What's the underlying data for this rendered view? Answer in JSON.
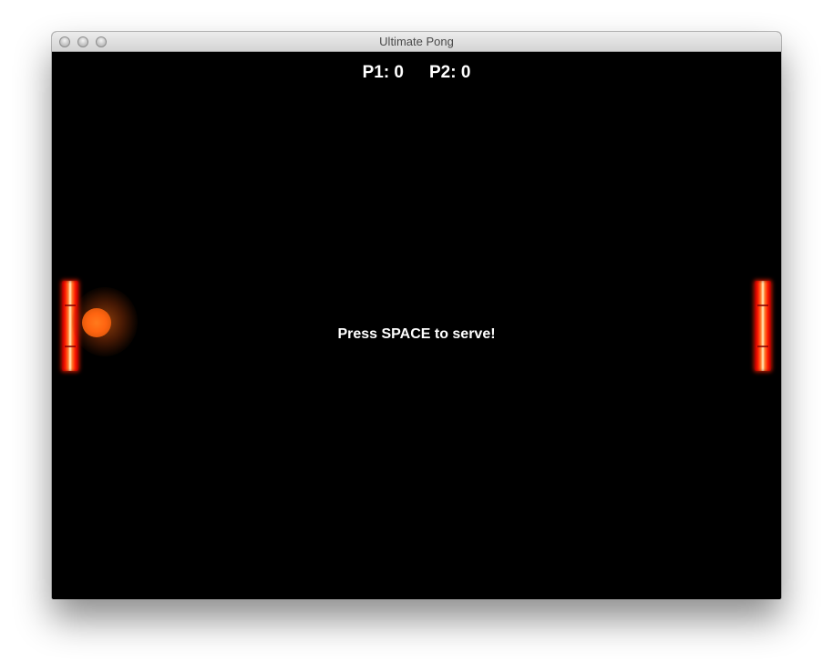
{
  "window": {
    "title": "Ultimate Pong"
  },
  "scoreboard": {
    "p1": "P1: 0",
    "p2": "P2: 0"
  },
  "status": {
    "message": "Press SPACE to serve!"
  },
  "colors": {
    "background": "#000000",
    "paddle": "#ff1a00",
    "ball": "#ff6410",
    "text": "#ffffff"
  }
}
